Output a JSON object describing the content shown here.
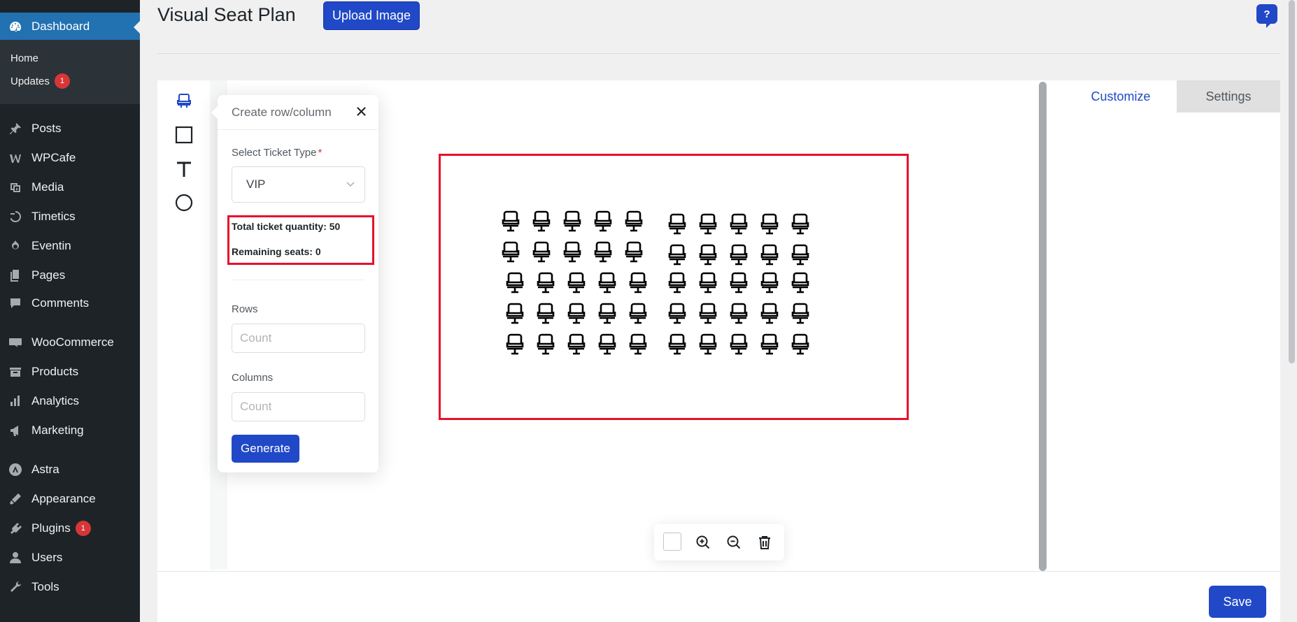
{
  "sidebar": {
    "items": [
      {
        "label": "Dashboard",
        "icon": "dashboard-icon",
        "current": true
      },
      {
        "label": "Posts",
        "icon": "pin-icon"
      },
      {
        "label": "WPCafe",
        "icon": "wpcafe-icon"
      },
      {
        "label": "Media",
        "icon": "media-icon"
      },
      {
        "label": "Timetics",
        "icon": "timetics-icon"
      },
      {
        "label": "Eventin",
        "icon": "eventin-icon"
      },
      {
        "label": "Pages",
        "icon": "pages-icon"
      },
      {
        "label": "Comments",
        "icon": "comments-icon"
      },
      {
        "label": "WooCommerce",
        "icon": "woocommerce-icon"
      },
      {
        "label": "Products",
        "icon": "products-icon"
      },
      {
        "label": "Analytics",
        "icon": "analytics-icon"
      },
      {
        "label": "Marketing",
        "icon": "marketing-icon"
      },
      {
        "label": "Astra",
        "icon": "astra-icon"
      },
      {
        "label": "Appearance",
        "icon": "appearance-icon"
      },
      {
        "label": "Plugins",
        "icon": "plugins-icon",
        "badge": "1"
      },
      {
        "label": "Users",
        "icon": "users-icon"
      },
      {
        "label": "Tools",
        "icon": "tools-icon"
      }
    ],
    "submenu": [
      {
        "label": "Home"
      },
      {
        "label": "Updates",
        "badge": "1"
      }
    ]
  },
  "header": {
    "title": "Visual Seat Plan",
    "upload_label": "Upload Image",
    "help_label": "?"
  },
  "tabs": [
    {
      "label": "Customize",
      "active": true
    },
    {
      "label": "Settings",
      "active": false
    }
  ],
  "popup": {
    "title": "Create row/column",
    "ticket_type_label": "Select Ticket Type",
    "required_mark": "*",
    "ticket_type_value": "VIP",
    "total_quantity": "Total ticket quantity: 50",
    "remaining_seats": "Remaining seats: 0",
    "rows_label": "Rows",
    "rows_placeholder": "Count",
    "columns_label": "Columns",
    "columns_placeholder": "Count",
    "generate_label": "Generate"
  },
  "seat_plan": {
    "rows": 5,
    "columns": 10,
    "seat_icon": "seat-icon"
  },
  "footer": {
    "save_label": "Save"
  },
  "colors": {
    "primary": "#2048c7",
    "highlight": "#e8102a",
    "admin_bg": "#1d2327",
    "admin_current": "#2271b1"
  }
}
